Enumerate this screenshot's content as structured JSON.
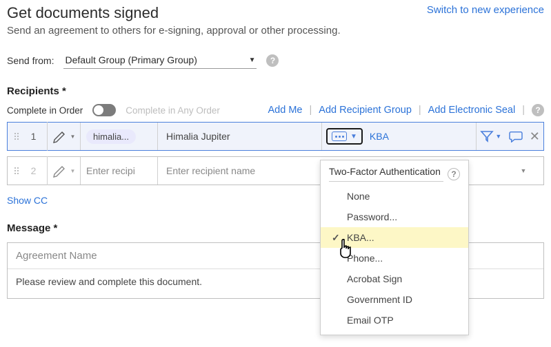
{
  "header": {
    "title": "Get documents signed",
    "subtitle": "Send an agreement to others for e-signing, approval or other processing.",
    "switch_link": "Switch to new experience"
  },
  "send_from": {
    "label": "Send from:",
    "value": "Default Group (Primary Group)"
  },
  "recipients": {
    "section_label": "Recipients *",
    "complete_in_order": "Complete in Order",
    "complete_any_order": "Complete in Any Order",
    "links": {
      "add_me": "Add Me",
      "add_group": "Add Recipient Group",
      "add_seal": "Add Electronic Seal"
    },
    "rows": [
      {
        "num": "1",
        "email_chip": "himalia...",
        "name": "Himalia Jupiter",
        "auth_label": "KBA"
      },
      {
        "num": "2",
        "email_placeholder": "Enter recipi",
        "name_placeholder": "Enter recipient name"
      }
    ],
    "show_cc": "Show CC"
  },
  "auth_dropdown": {
    "title": "Two-Factor Authentication",
    "items": [
      "None",
      "Password...",
      "KBA...",
      "Phone...",
      "Acrobat Sign",
      "Government ID",
      "Email OTP"
    ],
    "selected": "KBA..."
  },
  "message": {
    "section_label": "Message *",
    "name_placeholder": "Agreement Name",
    "body": "Please review and complete this document."
  }
}
